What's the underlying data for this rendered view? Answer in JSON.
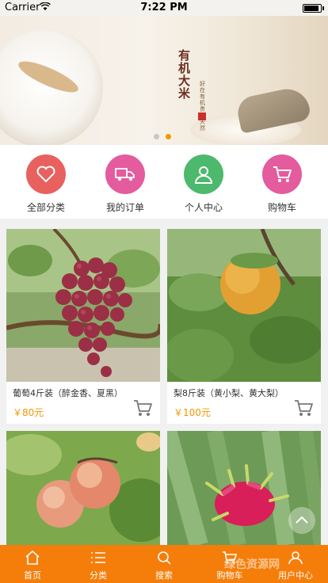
{
  "status_bar": {
    "carrier": "Carrier",
    "time": "7:22 PM"
  },
  "banner": {
    "title": "有机大米",
    "slogan": "好在有机贵在天然",
    "slide_count": 2,
    "active_slide": 2,
    "colors": {
      "dot_inactive": "#c8c8c8",
      "dot_active": "#f39800"
    }
  },
  "quick_nav": [
    {
      "label": "全部分类",
      "icon": "heart-icon",
      "color": "#e8615e"
    },
    {
      "label": "我的订单",
      "icon": "truck-icon",
      "color": "#e45b9e"
    },
    {
      "label": "个人中心",
      "icon": "person-icon",
      "color": "#4cb96d"
    },
    {
      "label": "购物车",
      "icon": "cart-icon",
      "color": "#e45b9e"
    }
  ],
  "products": [
    {
      "name": "葡萄4斤装（醉金香、夏黑）",
      "price": "￥80元",
      "image": "grape-image"
    },
    {
      "name": "梨8斤装（黄小梨、黄大梨）",
      "price": "￥100元",
      "image": "pear-image"
    },
    {
      "name": "",
      "price": "",
      "image": "peach-image"
    },
    {
      "name": "",
      "price": "",
      "image": "dragon-fruit-image"
    }
  ],
  "tabbar": [
    {
      "label": "首页",
      "icon": "home-icon"
    },
    {
      "label": "分类",
      "icon": "list-icon"
    },
    {
      "label": "搜索",
      "icon": "search-icon"
    },
    {
      "label": "购物车",
      "icon": "cart-icon"
    },
    {
      "label": "用户中心",
      "icon": "user-icon"
    }
  ],
  "watermark": "绿色资源网",
  "colors": {
    "accent": "#f39800",
    "tabbar": "#f57e0a"
  }
}
